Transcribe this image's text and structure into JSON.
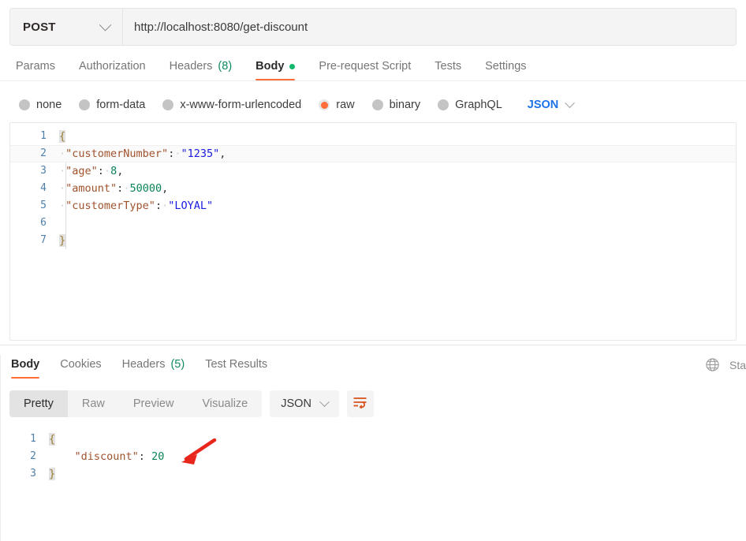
{
  "request": {
    "method": "POST",
    "method_icon": "chevron-down-icon",
    "url": "http://localhost:8080/get-discount",
    "url_placeholder": "Enter URL or paste text",
    "tabs": [
      {
        "label": "Params",
        "active": false
      },
      {
        "label": "Authorization",
        "active": false
      },
      {
        "label": "Headers",
        "count": "(8)",
        "active": false
      },
      {
        "label": "Body",
        "active": true,
        "dot": true
      },
      {
        "label": "Pre-request Script",
        "active": false
      },
      {
        "label": "Tests",
        "active": false
      },
      {
        "label": "Settings",
        "active": false
      }
    ],
    "body_types": [
      {
        "label": "none",
        "checked": false
      },
      {
        "label": "form-data",
        "checked": false
      },
      {
        "label": "x-www-form-urlencoded",
        "checked": false
      },
      {
        "label": "raw",
        "checked": true
      },
      {
        "label": "binary",
        "checked": false
      },
      {
        "label": "GraphQL",
        "checked": false
      }
    ],
    "format_select": "JSON",
    "body_lines": [
      {
        "n": "1",
        "open_brace": "{"
      },
      {
        "n": "2",
        "key": "\"customerNumber\"",
        "colon": ":",
        "value": "\"1235\"",
        "vtype": "str",
        "comma": ","
      },
      {
        "n": "3",
        "key": "\"age\"",
        "colon": ":",
        "value": "8",
        "vtype": "num",
        "comma": ","
      },
      {
        "n": "4",
        "key": "\"amount\"",
        "colon": ":",
        "value": "50000",
        "vtype": "num",
        "comma": ","
      },
      {
        "n": "5",
        "key": "\"customerType\"",
        "colon": ":",
        "value": "\"LOYAL\"",
        "vtype": "str",
        "comma": ""
      },
      {
        "n": "6"
      },
      {
        "n": "7",
        "close_brace": "}"
      }
    ]
  },
  "response": {
    "tabs": [
      {
        "label": "Body",
        "active": true
      },
      {
        "label": "Cookies",
        "active": false
      },
      {
        "label": "Headers",
        "count": "(5)",
        "active": false
      },
      {
        "label": "Test Results",
        "active": false
      }
    ],
    "globe_icon": "globe-icon",
    "status_text": "Sta",
    "views": [
      {
        "label": "Pretty",
        "active": true
      },
      {
        "label": "Raw",
        "active": false
      },
      {
        "label": "Preview",
        "active": false
      },
      {
        "label": "Visualize",
        "active": false
      }
    ],
    "format_select": "JSON",
    "wrap_icon": "word-wrap-icon",
    "body_lines": [
      {
        "n": "1",
        "open_brace": "{"
      },
      {
        "n": "2",
        "key": "\"discount\"",
        "colon": ":",
        "value": "20",
        "vtype": "num"
      },
      {
        "n": "3",
        "close_brace": "}"
      }
    ],
    "annotation": {
      "type": "arrow",
      "color": "#e8261c",
      "points_to": "20"
    }
  },
  "colors": {
    "accent": "#ff6c37",
    "json_blue": "#1a73e8",
    "key_brown": "#a0522d",
    "string_blue": "#1a1ae0",
    "number_green": "#0b8457",
    "count_green": "#0f8a5f",
    "arrow_red": "#e8261c"
  }
}
